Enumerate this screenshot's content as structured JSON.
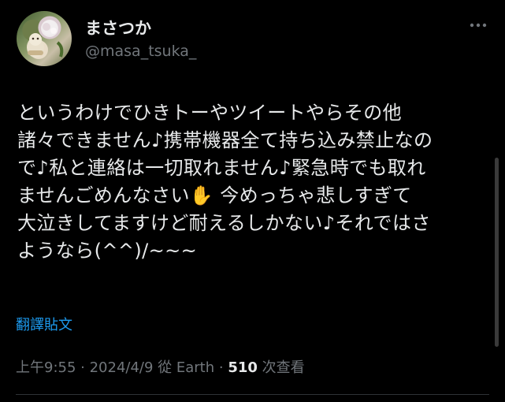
{
  "author": {
    "display_name": "まさつか",
    "handle": "@masa_tsuka_",
    "avatar_icon": "avatar-icon"
  },
  "more_icon": "more-horizontal-icon",
  "tweet": {
    "text": "というわけでひきトーやツイートやらその他\n諸々できません♪携帯機器全て持ち込み禁止なの\nで♪私と連絡は一切取れません♪緊急時でも取れ\nませんごめんなさい✋ 今めっちゃ悲しすぎて\n大泣きしてますけど耐えるしかない♪それではさ\nようなら(^^)/~~~"
  },
  "translate_label": "翻譯貼文",
  "meta": {
    "time": "上午9:55",
    "separator1": " · ",
    "date": "2024/4/9",
    "source": " 從 Earth",
    "separator2": " · ",
    "views_count": "510",
    "views_label": " 次查看"
  },
  "colors": {
    "background": "#000000",
    "text": "#e7e9ea",
    "secondary": "#71767b",
    "link": "#1d9bf0",
    "divider": "#2f3336"
  }
}
